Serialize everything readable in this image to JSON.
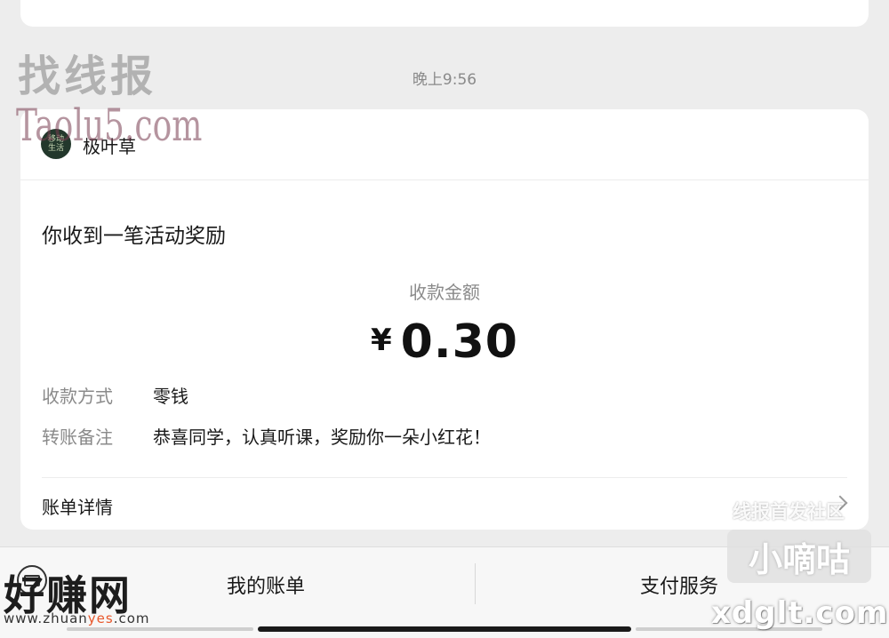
{
  "chat": {
    "timestamp": "晚上9:56"
  },
  "card": {
    "sender_name": "极叶草",
    "avatar_text": "移动生活",
    "title": "你收到一笔活动奖励",
    "amount_label": "收款金额",
    "currency_symbol": "¥",
    "amount_value": "0.30",
    "payment_method_label": "收款方式",
    "payment_method_value": "零钱",
    "transfer_note_label": "转账备注",
    "transfer_note_value": "恭喜同学，认真听课，奖励你一朵小红花！",
    "bill_detail_label": "账单详情"
  },
  "bottom_menu": {
    "my_bill": "我的账单",
    "pay_service": "支付服务"
  },
  "watermarks": {
    "zhaoxianbao": "找线报",
    "taolu": "Taolu5.com",
    "community": "线报首发社区",
    "xiaodigu": "小嘀咕",
    "xdglt": "xdglt.com",
    "haozhuan": "好赚网",
    "zhuanyes_prefix": "www.zhuan",
    "zhuanyes_highlight": "yes",
    "zhuanyes_suffix": ".com"
  },
  "icons": {
    "keyboard": "keyboard-icon",
    "chevron": "chevron-right-icon"
  }
}
